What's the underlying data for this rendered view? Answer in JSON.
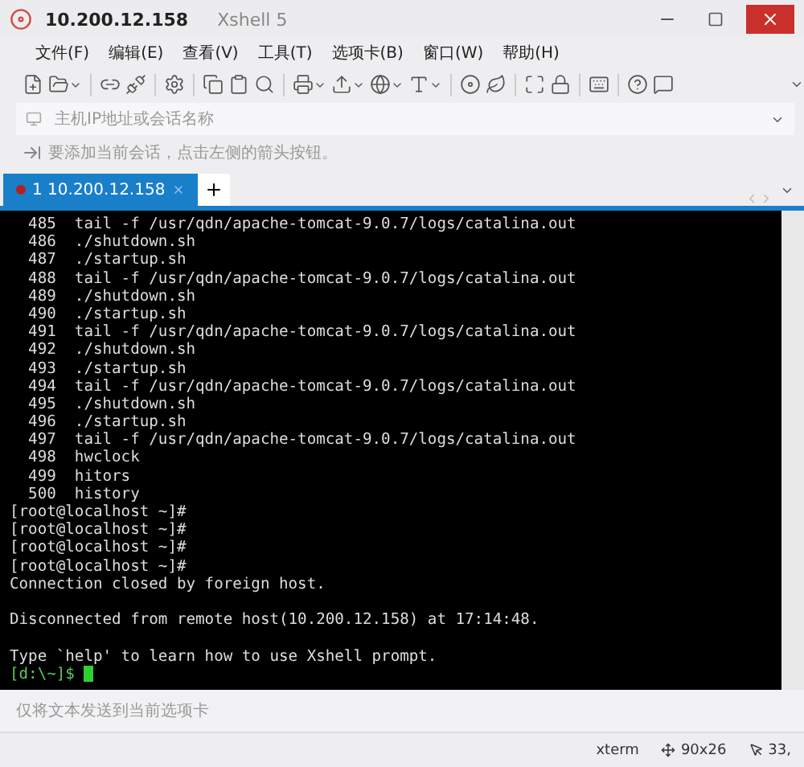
{
  "window": {
    "title": "10.200.12.158",
    "app": "Xshell 5"
  },
  "menu": [
    "文件(F)",
    "编辑(E)",
    "查看(V)",
    "工具(T)",
    "选项卡(B)",
    "窗口(W)",
    "帮助(H)"
  ],
  "address": {
    "placeholder": "主机IP地址或会话名称"
  },
  "hint": {
    "text": "要添加当前会话，点击左侧的箭头按钮。"
  },
  "tabs": [
    {
      "label": "1 10.200.12.158",
      "selected": true
    }
  ],
  "terminal": {
    "lines": [
      {
        "kind": "output",
        "text": "  485  tail -f /usr/qdn/apache-tomcat-9.0.7/logs/catalina.out"
      },
      {
        "kind": "output",
        "text": "  486  ./shutdown.sh"
      },
      {
        "kind": "output",
        "text": "  487  ./startup.sh"
      },
      {
        "kind": "output",
        "text": "  488  tail -f /usr/qdn/apache-tomcat-9.0.7/logs/catalina.out"
      },
      {
        "kind": "output",
        "text": "  489  ./shutdown.sh"
      },
      {
        "kind": "output",
        "text": "  490  ./startup.sh"
      },
      {
        "kind": "output",
        "text": "  491  tail -f /usr/qdn/apache-tomcat-9.0.7/logs/catalina.out"
      },
      {
        "kind": "output",
        "text": "  492  ./shutdown.sh"
      },
      {
        "kind": "output",
        "text": "  493  ./startup.sh"
      },
      {
        "kind": "output",
        "text": "  494  tail -f /usr/qdn/apache-tomcat-9.0.7/logs/catalina.out"
      },
      {
        "kind": "output",
        "text": "  495  ./shutdown.sh"
      },
      {
        "kind": "output",
        "text": "  496  ./startup.sh"
      },
      {
        "kind": "output",
        "text": "  497  tail -f /usr/qdn/apache-tomcat-9.0.7/logs/catalina.out"
      },
      {
        "kind": "output",
        "text": "  498  hwclock"
      },
      {
        "kind": "output",
        "text": "  499  hitors"
      },
      {
        "kind": "output",
        "text": "  500  history"
      },
      {
        "kind": "output",
        "text": "[root@localhost ~]#"
      },
      {
        "kind": "output",
        "text": "[root@localhost ~]#"
      },
      {
        "kind": "output",
        "text": "[root@localhost ~]#"
      },
      {
        "kind": "output",
        "text": "[root@localhost ~]#"
      },
      {
        "kind": "output",
        "text": "Connection closed by foreign host."
      },
      {
        "kind": "blank"
      },
      {
        "kind": "output",
        "text": "Disconnected from remote host(10.200.12.158) at 17:14:48."
      },
      {
        "kind": "blank"
      },
      {
        "kind": "output",
        "text": "Type `help' to learn how to use Xshell prompt."
      },
      {
        "kind": "prompt",
        "text": "[d:\\~]$ "
      }
    ]
  },
  "send_bar": {
    "placeholder": "仅将文本发送到当前选项卡"
  },
  "status_bar": {
    "terminal_type": "xterm",
    "size": "90x26",
    "cursor": "33,"
  }
}
